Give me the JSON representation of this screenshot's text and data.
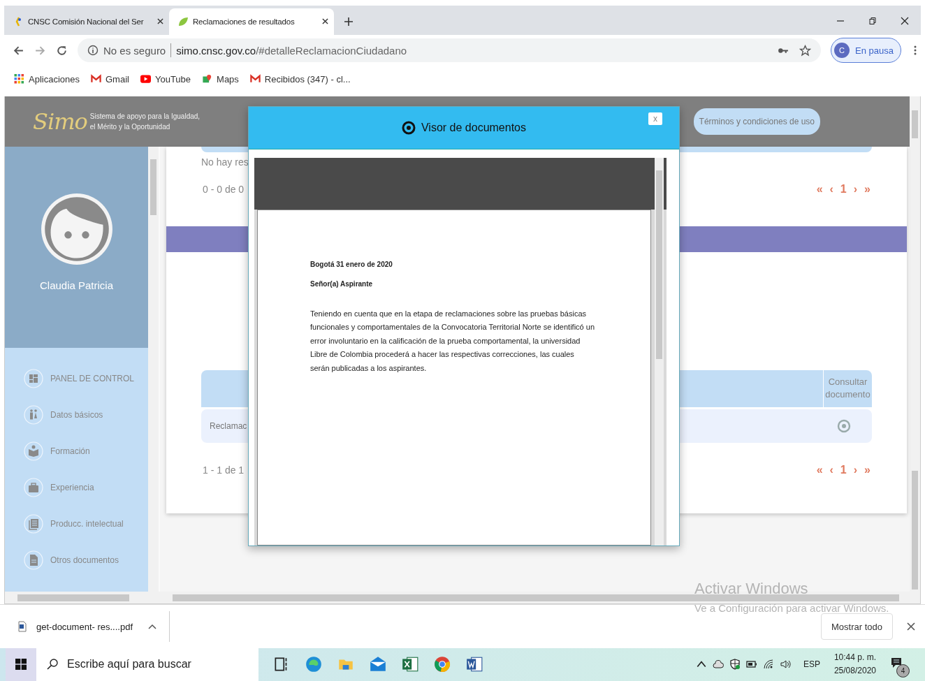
{
  "browser": {
    "tabs": [
      {
        "title": "CNSC Comisión Nacional del Ser",
        "selected": false
      },
      {
        "title": "Reclamaciones de resultados",
        "selected": true
      }
    ],
    "security": "No es seguro",
    "url_host": "simo.cnsc.gov.co",
    "url_path": "/#detalleReclamacionCiudadano",
    "profile": {
      "initial": "C",
      "status": "En pausa"
    },
    "bookmarks": [
      {
        "kind": "apps",
        "label": "Aplicaciones"
      },
      {
        "kind": "gmail",
        "label": "Gmail"
      },
      {
        "kind": "youtube",
        "label": "YouTube"
      },
      {
        "kind": "maps",
        "label": "Maps"
      },
      {
        "kind": "gmail",
        "label": "Recibidos (347) - cl..."
      }
    ]
  },
  "site": {
    "logo_mark": "Simo",
    "logo_line_1": "Sistema de apoyo para la Igualdad,",
    "logo_line_2": "el Mérito y la Oportunidad",
    "terms_button": "Términos y condiciones de uso",
    "user_name": "Claudia Patricia",
    "menu": [
      {
        "kind": "dashboard",
        "label": "PANEL DE CONTROL"
      },
      {
        "kind": "people",
        "label": "Datos básicos"
      },
      {
        "kind": "education",
        "label": "Formación"
      },
      {
        "kind": "briefcase",
        "label": "Experiencia"
      },
      {
        "kind": "library",
        "label": "Producc. intelectual"
      },
      {
        "kind": "file",
        "label": "Otros documentos"
      }
    ],
    "empty_text": "No hay res",
    "range_top": "0 - 0 de 0",
    "pager_top": {
      "first": "«",
      "prev": "‹",
      "page": "1",
      "next": "›",
      "last": "»"
    },
    "table": {
      "column": "Consultar documento",
      "cell": "Reclamac"
    },
    "range_bottom": "1 - 1 de 1",
    "pager_bottom": {
      "first": "«",
      "prev": "‹",
      "page": "1",
      "next": "›",
      "last": "»"
    }
  },
  "modal": {
    "title": "Visor de documentos",
    "close": "x",
    "document": {
      "date": "Bogotá 31 enero de 2020",
      "salutation": "Señor(a) Aspirante",
      "body": "Teniendo en cuenta que en la etapa de reclamaciones sobre las pruebas básicas funcionales y comportamentales de la Convocatoria Territorial Norte se identificó un error involuntario en la calificación de la prueba comportamental, la universidad Libre de Colombia procederá a hacer las respectivas correcciones, las cuales serán publicadas a los aspirantes."
    }
  },
  "downloads": {
    "file": "get-document- res....pdf",
    "show_all": "Mostrar todo"
  },
  "os": {
    "activation_title": "Activar Windows",
    "activation_text": "Ve a Configuración para activar Windows.",
    "search_placeholder": "Escribe aquí para buscar",
    "language": "ESP",
    "time": "10:44 p. m.",
    "date": "25/08/2020",
    "notifications": "4"
  }
}
